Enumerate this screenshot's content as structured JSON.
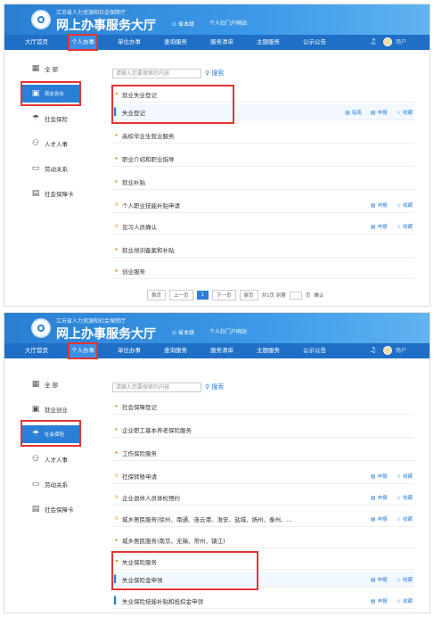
{
  "header": {
    "subtitle": "江苏省人力资源和社会保障厅",
    "title": "网上办事服务大厅",
    "location": "省本级",
    "site_link": "个人社门户网站",
    "avatar_text": "用户"
  },
  "nav": [
    "大厅首页",
    "个人办事",
    "单位办事",
    "查询服务",
    "服务清单",
    "主题服务",
    "公示公告"
  ],
  "sidebar": [
    "全 部",
    "就业创业",
    "社会保险",
    "人才人事",
    "劳动关系",
    "社会保障卡"
  ],
  "search": {
    "placeholder": "请输入您要搜索的内容",
    "button": "搜索"
  },
  "actions": {
    "handle": "指南",
    "apply": "申报",
    "fav": "收藏"
  },
  "panel1": {
    "rows": [
      {
        "label": "就业失业登记",
        "type": "parent"
      },
      {
        "label": "失业登记",
        "type": "child",
        "acts": true,
        "handle": true
      },
      {
        "label": "高校毕业生就业服务",
        "type": "parent"
      },
      {
        "label": "职业介绍和职业指导",
        "type": "parent"
      },
      {
        "label": "就业补贴",
        "type": "parent"
      },
      {
        "label": "个人职业技能补贴申请",
        "type": "item",
        "acts": true
      },
      {
        "label": "见习人员确认",
        "type": "item",
        "acts": true
      },
      {
        "label": "就业培训备案和补贴",
        "type": "parent"
      },
      {
        "label": "创业服务",
        "type": "parent"
      }
    ],
    "pager": {
      "first": "首页",
      "prev": "上一页",
      "cur": "1",
      "next": "下一页",
      "last": "尾页",
      "total": "共1页 到第",
      "page": "页",
      "ok": "确认"
    }
  },
  "panel2": {
    "rows": [
      {
        "label": "社会保障登记",
        "type": "parent"
      },
      {
        "label": "企业职工基本养老保险服务",
        "type": "parent"
      },
      {
        "label": "工伤保险服务",
        "type": "parent"
      },
      {
        "label": "社保转移申请",
        "type": "item",
        "acts": true
      },
      {
        "label": "企业退休人员体检预约",
        "type": "item",
        "acts": true
      },
      {
        "label": "城乡居民服务(徐州、南通、连云港、淮安、盐城、扬州、泰州、...",
        "type": "item",
        "acts": true
      },
      {
        "label": "城乡居民服务(南京、无锡、常州、镇江)",
        "type": "parent"
      },
      {
        "label": "失业保险服务",
        "type": "parent"
      },
      {
        "label": "失业保险金申领",
        "type": "child",
        "acts": true
      },
      {
        "label": "失业保险技能补贴和抵扣金申领",
        "type": "item",
        "acts": true
      }
    ]
  },
  "colors": {
    "header": "#2a7fd2",
    "nav": "#1f6fc6",
    "accent": "#2b7fd6",
    "highlight": "#e53333",
    "marker": "#f08c1e"
  }
}
